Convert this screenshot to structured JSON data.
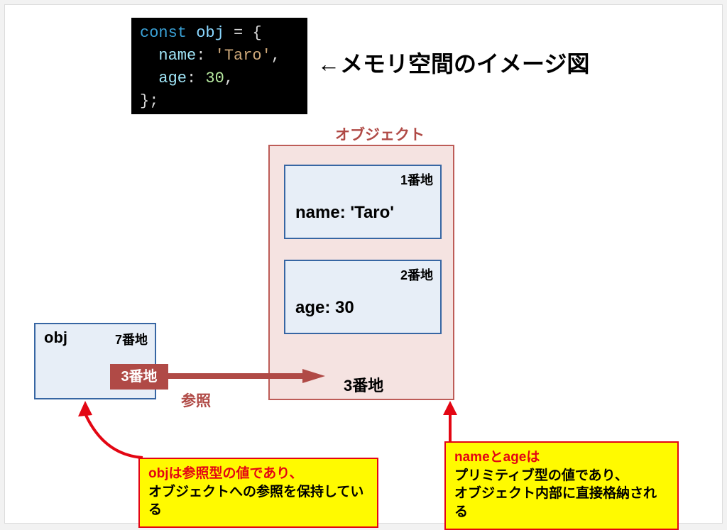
{
  "title": "←メモリ空間のイメージ図",
  "code": {
    "kw_const": "const",
    "var": "obj",
    "eq": " = ",
    "brace_open": "{",
    "prop1": "name",
    "colon1": ": ",
    "str": "'Taro'",
    "comma1": ",",
    "prop2": "age",
    "colon2": ": ",
    "num": "30",
    "comma2": ",",
    "brace_close": "};"
  },
  "variable": {
    "name": "obj",
    "addr": "7番地",
    "ref_value": "3番地"
  },
  "reference_label": "参照",
  "object": {
    "label": "オブジェクト",
    "addr": "3番地",
    "props": [
      {
        "addr": "1番地",
        "value": "name: 'Taro'"
      },
      {
        "addr": "2番地",
        "value": "age: 30"
      }
    ]
  },
  "notes": {
    "left_red": "objは参照型の値であり、",
    "left_black": "オブジェクトへの参照を保持している",
    "right_red": "nameとageは",
    "right_black1": "プリミティブ型の値であり、",
    "right_black2": "オブジェクト内部に直接格納される"
  },
  "colors": {
    "accent_blue": "#3766a3",
    "accent_red": "#b04a46",
    "note_bg": "#fffa00",
    "note_border": "#e30613"
  }
}
